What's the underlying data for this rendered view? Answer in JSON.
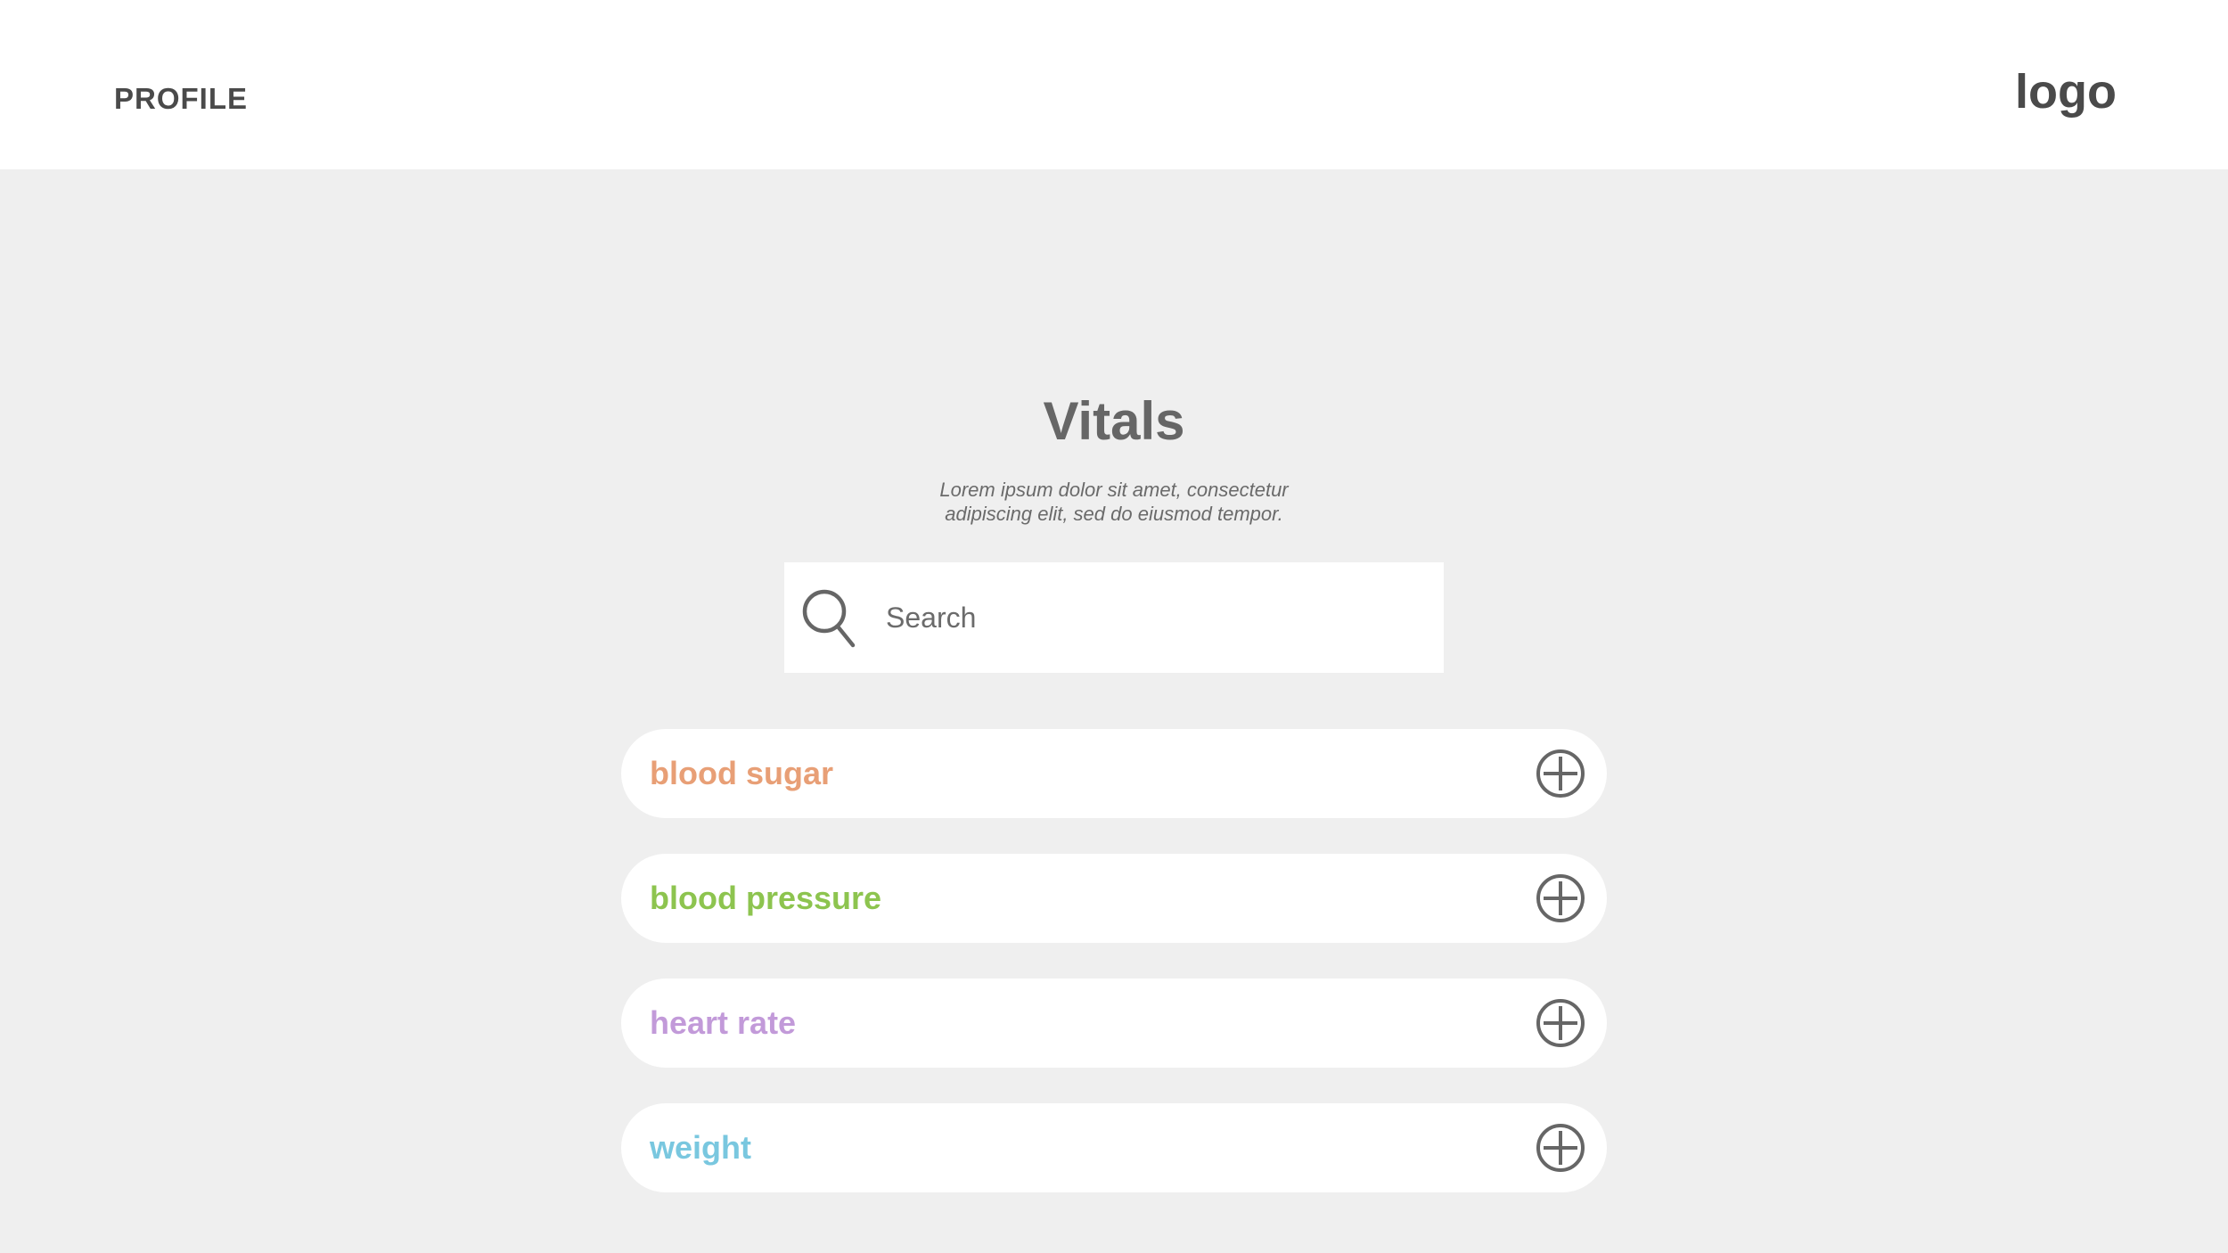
{
  "header": {
    "profile_label": "PROFILE",
    "logo_text": "logo"
  },
  "main": {
    "title": "Vitals",
    "subtitle_line1": "Lorem ipsum dolor sit amet, consectetur",
    "subtitle_line2": "adipiscing elit, sed do eiusmod tempor."
  },
  "search": {
    "placeholder": "Search",
    "value": "",
    "icon": "search-icon"
  },
  "vitals": [
    {
      "label": "blood sugar",
      "color": "#e89f76",
      "icon": "add-circle-icon"
    },
    {
      "label": "blood pressure",
      "color": "#8dc44f",
      "icon": "add-circle-icon"
    },
    {
      "label": "heart rate",
      "color": "#c29ad9",
      "icon": "add-circle-icon"
    },
    {
      "label": "weight",
      "color": "#79c7df",
      "icon": "add-circle-icon"
    }
  ]
}
